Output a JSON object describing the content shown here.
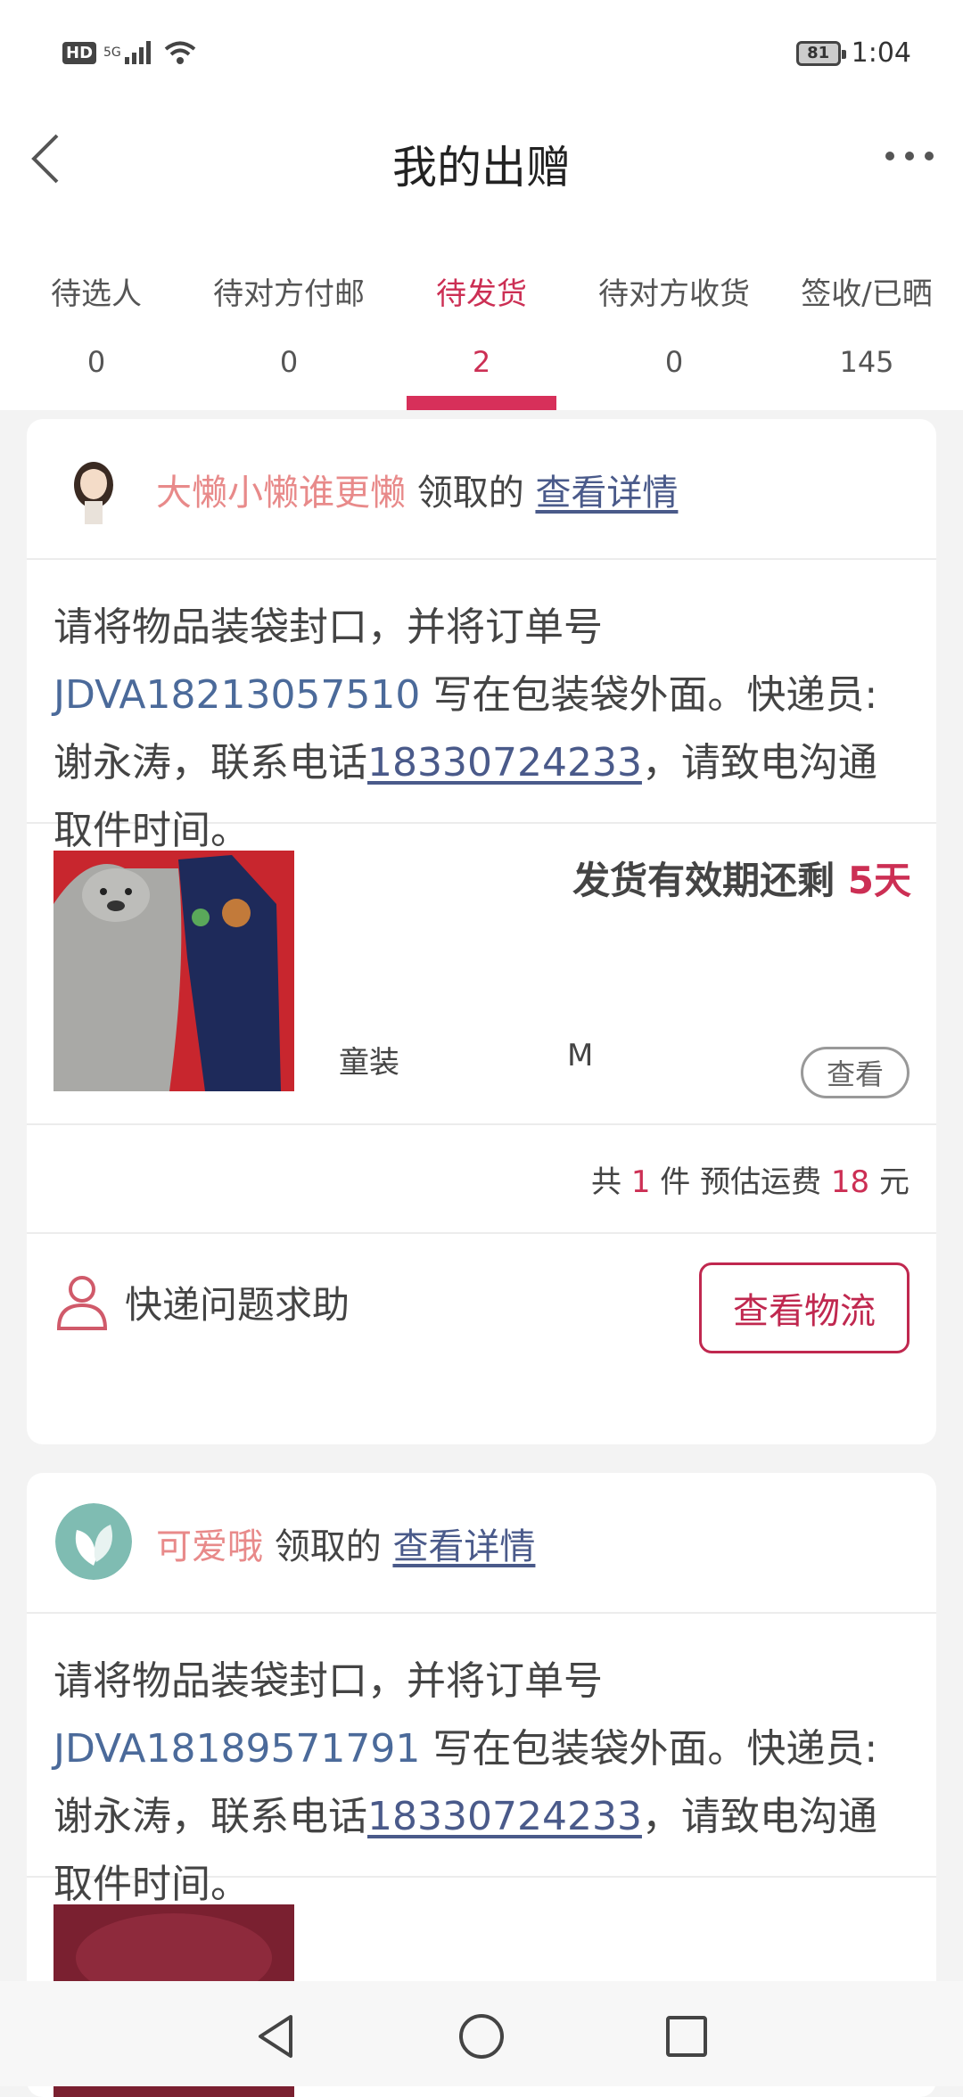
{
  "status_bar": {
    "hd": "HD",
    "network": "5G",
    "battery": "81",
    "time": "1:04"
  },
  "header": {
    "title": "我的出赠"
  },
  "tabs": [
    {
      "label": "待选人",
      "count": "0"
    },
    {
      "label": "待对方付邮",
      "count": "0"
    },
    {
      "label": "待发货",
      "count": "2"
    },
    {
      "label": "待对方收货",
      "count": "0"
    },
    {
      "label": "签收/已晒",
      "count": "145"
    }
  ],
  "active_tab": "待发货",
  "colors": {
    "accent": "#cc2f54",
    "link": "#4a5a8a",
    "name": "#e88a8a"
  },
  "orders": [
    {
      "receiver_name": "大懒小懒谁更懒",
      "receiver_suffix": "领取的",
      "detail_link": "查看详情",
      "instruction_prefix": "请将物品装袋封口，并将订单号 ",
      "order_no": "JDVA18213057510",
      "instruction_mid": " 写在包装袋外面。快递员:谢永涛，联系电话",
      "phone": "18330724233",
      "instruction_suffix": "，请致电沟通取件时间。",
      "deadline_label": "发货有效期还剩 ",
      "deadline_days": "5天",
      "category": "童装",
      "size": "M",
      "view_label": "查看",
      "summary_count_prefix": "共 ",
      "summary_count": "1",
      "summary_count_suffix": " 件 预估运费 ",
      "summary_fee": "18",
      "summary_fee_suffix": " 元",
      "help_label": "快递问题求助",
      "logistics_label": "查看物流"
    },
    {
      "receiver_name": "可爱哦",
      "receiver_suffix": "领取的",
      "detail_link": "查看详情",
      "instruction_prefix": "请将物品装袋封口，并将订单号 ",
      "order_no": "JDVA18189571791",
      "instruction_mid": " 写在包装袋外面。快递员:谢永涛，联系电话",
      "phone": "18330724233",
      "instruction_suffix": "，请致电沟通取件时间。"
    }
  ],
  "nav_icons": [
    "back-nav-icon",
    "home-nav-icon",
    "recents-nav-icon"
  ]
}
